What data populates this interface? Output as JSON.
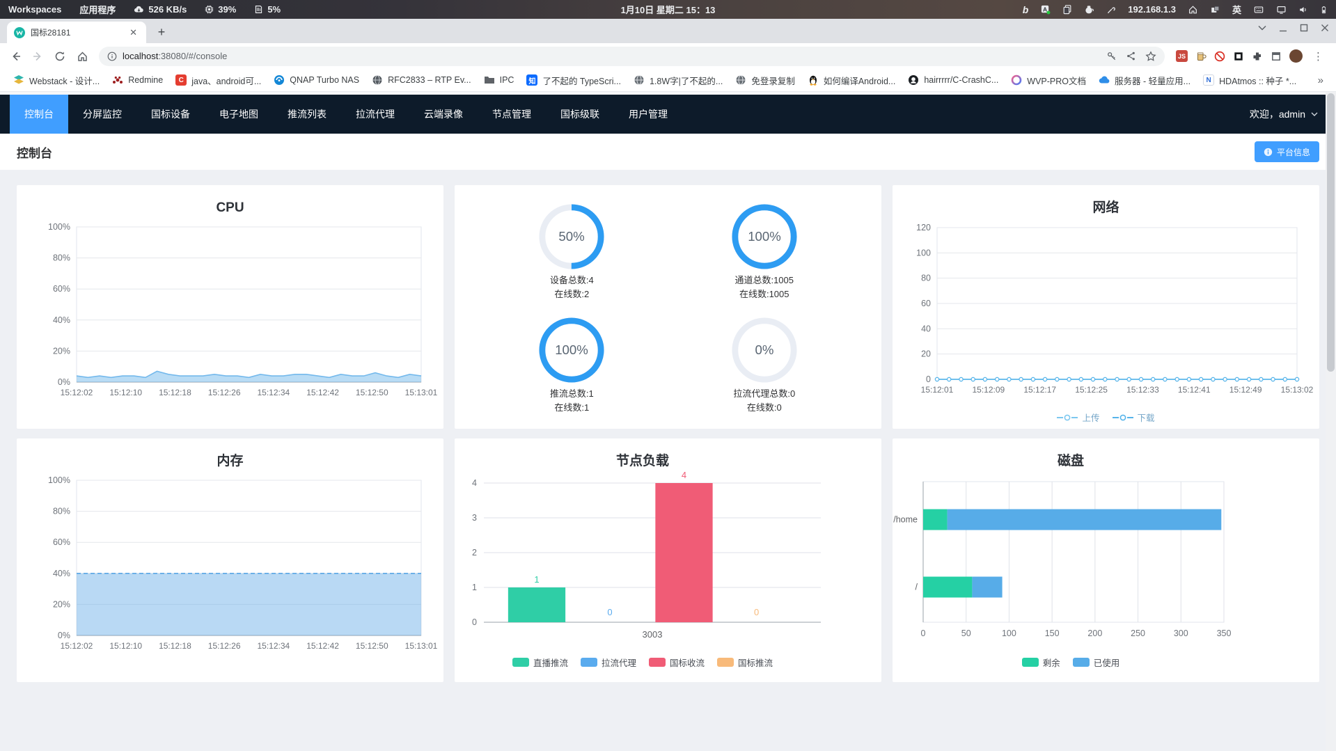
{
  "system_bar": {
    "workspaces": "Workspaces",
    "applications": "应用程序",
    "network_speed": "526 KB/s",
    "cpu_usage": "39%",
    "memory_usage": "5%",
    "clock": "1月10日 星期二 15：13",
    "ip_address": "192.168.1.3",
    "input_method": "英"
  },
  "browser": {
    "tab_title": "国标28181",
    "url_host": "localhost",
    "url_rest": ":38080/#/console",
    "new_tab_glyph": "+",
    "close_glyph": "✕",
    "menu_glyph": "⋮",
    "overflow_chevron": "»",
    "bookmarks": [
      {
        "label": "Webstack - 设计...",
        "icon": "layers-icon"
      },
      {
        "label": "Redmine",
        "icon": "redmine-icon"
      },
      {
        "label": "java、android可...",
        "icon": "csdn-icon"
      },
      {
        "label": "QNAP Turbo NAS",
        "icon": "qnap-icon"
      },
      {
        "label": "RFC2833 – RTP Ev...",
        "icon": "globe-dark-icon"
      },
      {
        "label": "IPC",
        "icon": "folder-icon"
      },
      {
        "label": "了不起的 TypeScri...",
        "icon": "zhihu-icon"
      },
      {
        "label": "1.8W字|了不起的...",
        "icon": "globe-icon"
      },
      {
        "label": "免登录复制",
        "icon": "globe-icon"
      },
      {
        "label": "如何编译Android...",
        "icon": "penguin-icon"
      },
      {
        "label": "hairrrrr/C-CrashC...",
        "icon": "github-icon"
      },
      {
        "label": "WVP-PRO文档",
        "icon": "wvp-icon"
      },
      {
        "label": "服务器 - 轻量应用...",
        "icon": "cloud-icon"
      },
      {
        "label": "HDAtmos :: 种子 *...",
        "icon": "n-icon"
      }
    ]
  },
  "nav": {
    "tabs": [
      "控制台",
      "分屏监控",
      "国标设备",
      "电子地图",
      "推流列表",
      "拉流代理",
      "云端录像",
      "节点管理",
      "国标级联",
      "用户管理"
    ],
    "active_tab": "控制台",
    "welcome": "欢迎，admin"
  },
  "page": {
    "title": "控制台",
    "platform_info_button": "平台信息"
  },
  "colors": {
    "accent": "#409eff",
    "navbar_bg": "#0d1b2a",
    "ring_blue": "#2d9cf2",
    "ring_track": "#e9edf4",
    "cpu_line": "#74b9ec",
    "green": "#2fcea6",
    "blue": "#5aabee",
    "red": "#f05c76",
    "orange": "#f8ba7a"
  },
  "chart_data": [
    {
      "id": "cpu",
      "type": "area",
      "title": "CPU",
      "ymax": 100,
      "ytick_values": [
        0,
        20,
        40,
        60,
        80,
        100
      ],
      "y_suffix": "%",
      "x_ticks": [
        "15:12:02",
        "15:12:10",
        "15:12:18",
        "15:12:26",
        "15:12:34",
        "15:12:42",
        "15:12:50",
        "15:13:01"
      ],
      "values": [
        4,
        3,
        4,
        3,
        4,
        4,
        3,
        7,
        5,
        4,
        4,
        4,
        5,
        4,
        4,
        3,
        5,
        4,
        4,
        5,
        5,
        4,
        3,
        5,
        4,
        4,
        6,
        4,
        3,
        5,
        4
      ],
      "line_color": "#74b9ec",
      "fill_color": "rgba(116,185,236,0.5)"
    },
    {
      "id": "gauges",
      "type": "gauge",
      "ring_color": "#2d9cf2",
      "track_color": "#e9edf4",
      "items": [
        {
          "percent": 50,
          "total_label": "设备总数:4",
          "online_label": "在线数:2"
        },
        {
          "percent": 100,
          "total_label": "通道总数:1005",
          "online_label": "在线数:1005"
        },
        {
          "percent": 100,
          "total_label": "推流总数:1",
          "online_label": "在线数:1"
        },
        {
          "percent": 0,
          "total_label": "拉流代理总数:0",
          "online_label": "在线数:0"
        }
      ]
    },
    {
      "id": "network",
      "type": "line",
      "title": "网络",
      "ymax": 120,
      "ytick_values": [
        0,
        20,
        40,
        60,
        80,
        100,
        120
      ],
      "y_suffix": "",
      "x_ticks": [
        "15:12:01",
        "15:12:09",
        "15:12:17",
        "15:12:25",
        "15:12:33",
        "15:12:41",
        "15:12:49",
        "15:13:02"
      ],
      "series": [
        {
          "name": "上传",
          "color": "#7cc8f0",
          "markers": true,
          "values": [
            0,
            0,
            0,
            0,
            0,
            0,
            0,
            0,
            0,
            0,
            0,
            0,
            0,
            0,
            0,
            0,
            0,
            0,
            0,
            0,
            0,
            0,
            0,
            0,
            0,
            0,
            0,
            0,
            0,
            0,
            0
          ]
        },
        {
          "name": "下载",
          "color": "#56b4ea",
          "markers": true,
          "values": [
            0,
            0,
            0,
            0,
            0,
            0,
            0,
            0,
            0,
            0,
            0,
            0,
            0,
            0,
            0,
            0,
            0,
            0,
            0,
            0,
            0,
            0,
            0,
            0,
            0,
            0,
            0,
            0,
            0,
            0,
            0
          ]
        }
      ],
      "legend": [
        "上传",
        "下载"
      ]
    },
    {
      "id": "memory",
      "type": "area",
      "title": "内存",
      "ymax": 100,
      "ytick_values": [
        0,
        20,
        40,
        60,
        80,
        100
      ],
      "y_suffix": "%",
      "x_ticks": [
        "15:12:02",
        "15:12:10",
        "15:12:18",
        "15:12:26",
        "15:12:34",
        "15:12:42",
        "15:12:50",
        "15:13:01"
      ],
      "values": [
        40,
        40,
        40,
        40,
        40,
        40,
        40,
        40,
        40,
        40,
        40,
        40,
        40,
        40,
        40,
        40,
        40,
        40,
        40,
        40,
        40,
        40,
        40,
        40,
        40,
        40,
        40,
        40,
        40,
        40,
        40
      ],
      "line_color": "#5aa6e4",
      "fill_color": "rgba(100,170,230,0.45)",
      "dashed": true
    },
    {
      "id": "node_load",
      "type": "bar",
      "title": "节点负载",
      "category": "3003",
      "ymax": 4,
      "ytick_values": [
        0,
        1,
        2,
        3,
        4
      ],
      "bars": [
        {
          "name": "直播推流",
          "value": 1,
          "color": "#2fcea6"
        },
        {
          "name": "拉流代理",
          "value": 0,
          "color": "#5aabee"
        },
        {
          "name": "国标收流",
          "value": 4,
          "color": "#f05c76"
        },
        {
          "name": "国标推流",
          "value": 0,
          "color": "#f8ba7a"
        }
      ]
    },
    {
      "id": "disk",
      "type": "hbar",
      "title": "磁盘",
      "categories": [
        "/home",
        "/"
      ],
      "xmax": 350,
      "xtick_values": [
        0,
        50,
        100,
        150,
        200,
        250,
        300,
        350
      ],
      "series": [
        {
          "name": "剩余",
          "color": "#25d0a4",
          "values": [
            28,
            57
          ]
        },
        {
          "name": "已使用",
          "color": "#57ace8",
          "values": [
            319,
            35
          ]
        }
      ]
    }
  ]
}
